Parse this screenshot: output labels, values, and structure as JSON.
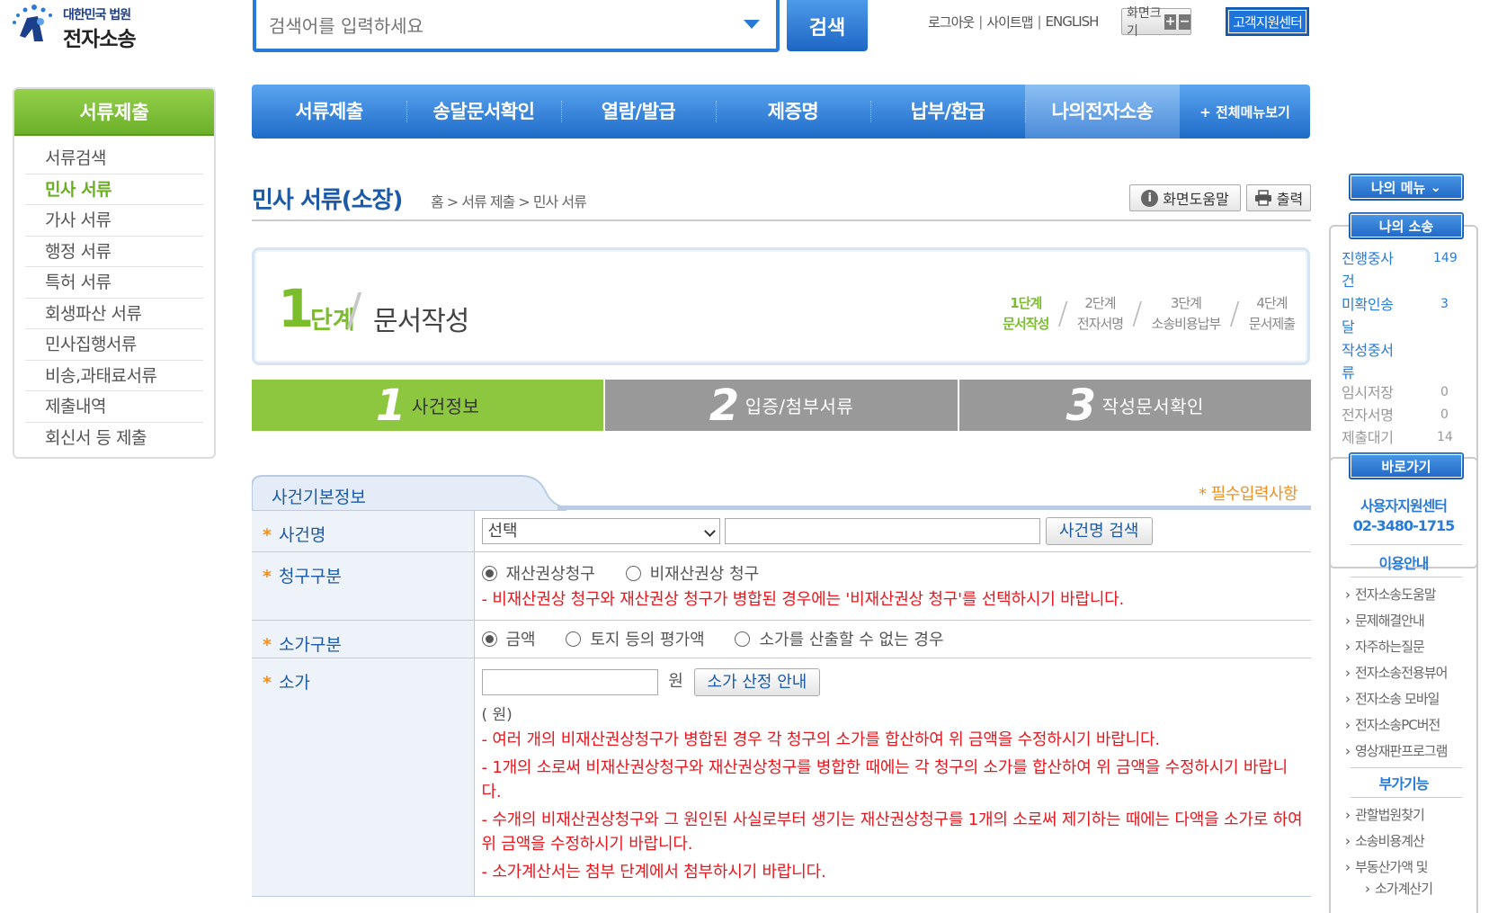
{
  "header": {
    "logo_line1": "대한민국 법원",
    "logo_line2": "전자소송",
    "search_placeholder": "검색어를 입력하세요",
    "search_button": "검색",
    "util_links": [
      "로그아웃",
      "사이트맵",
      "ENGLISH"
    ],
    "font_size_label": "화면크기",
    "font_plus": "+",
    "font_minus": "−",
    "support_center": "고객지원센터"
  },
  "gnb": {
    "items": [
      "서류제출",
      "송달문서확인",
      "열람/발급",
      "제증명",
      "납부/환급",
      "나의전자소송"
    ],
    "all_menu": "+ 전체메뉴보기"
  },
  "sidebar": {
    "title": "서류제출",
    "items": [
      "서류검색",
      "민사 서류",
      "가사 서류",
      "행정 서류",
      "특허 서류",
      "회생파산 서류",
      "민사집행서류",
      "비송,과태료서류",
      "제출내역",
      "회신서 등 제출"
    ],
    "active_index": 1
  },
  "page": {
    "title": "민사 서류(소장)",
    "breadcrumb": "홈 > 서류 제출 > 민사 서류",
    "help_button": "화면도움말",
    "print_button": "출력"
  },
  "step": {
    "number": "1",
    "unit": "단계",
    "name": "문서작성",
    "mini_steps": [
      {
        "step": "1단계",
        "name": "문서작성"
      },
      {
        "step": "2단계",
        "name": "전자서명"
      },
      {
        "step": "3단계",
        "name": "소송비용납부"
      },
      {
        "step": "4단계",
        "name": "문서제출"
      }
    ]
  },
  "tabs": [
    {
      "num": "1",
      "label": "사건정보"
    },
    {
      "num": "2",
      "label": "입증/첨부서류"
    },
    {
      "num": "3",
      "label": "작성문서확인"
    }
  ],
  "section": {
    "title": "사건기본정보",
    "required_note": "* 필수입력사항"
  },
  "form": {
    "case_name": {
      "label": "사건명",
      "select_value": "선택",
      "search_button": "사건명 검색"
    },
    "claim_type": {
      "label": "청구구분",
      "options": [
        "재산권상청구",
        "비재산권상 청구"
      ],
      "note": "- 비재산권상 청구와 재산권상 청구가 병합된 경우에는 '비재산권상 청구'를 선택하시기 바랍니다."
    },
    "value_type": {
      "label": "소가구분",
      "options": [
        "금액",
        "토지 등의 평가액",
        "소가를 산출할 수 없는 경우"
      ]
    },
    "value": {
      "label": "소가",
      "unit": "원",
      "calc_button": "소가 산정 안내",
      "sub": "( 원)",
      "notes": [
        "- 여러 개의 비재산권상청구가 병합된 경우 각 청구의 소가를 합산하여 위 금액을 수정하시기 바랍니다.",
        "- 1개의 소로써 비재산권상청구와 재산권상청구를 병합한 때에는 각 청구의 소가를 합산하여 위 금액을 수정하시기 바랍니다.",
        "- 수개의 비재산권상청구와 그 원인된 사실로부터 생기는 재산권상청구를 1개의 소로써 제기하는 때에는 다액을 소가로 하여 위 금액을 수정하시기 바랍니다.",
        "- 소가계산서는 첨부 단계에서 첨부하시기 바랍니다."
      ]
    }
  },
  "quick": {
    "my_menu": "나의 메뉴",
    "my_case": "나의 소송",
    "stats": [
      {
        "label": "진행중사건",
        "value": "149"
      },
      {
        "label": "미확인송달",
        "value": "3"
      },
      {
        "label": "작성중서류",
        "value": ""
      },
      {
        "label": "임시저장",
        "value": "0"
      },
      {
        "label": "전자서명",
        "value": "0"
      },
      {
        "label": "제출대기",
        "value": "14"
      }
    ],
    "shortcut": "바로가기",
    "center_name": "사용자지원센터",
    "center_phone": "02-3480-1715",
    "guide_title": "이용안내",
    "guide_links": [
      "전자소송도움말",
      "문제해결안내",
      "자주하는질문",
      "전자소송전용뷰어",
      "전자소송 모바일",
      "전자소송PC버전",
      "영상재판프로그램"
    ],
    "extra_title": "부가기능",
    "extra_links": [
      "관할법원찾기",
      "소송비용계산",
      "부동산가액 및",
      "소가계산기"
    ]
  },
  "colors": {
    "primary_blue": "#1f6cc9",
    "green": "#8dc63f",
    "required_orange": "#f09020",
    "notice_red": "#e8161d"
  }
}
